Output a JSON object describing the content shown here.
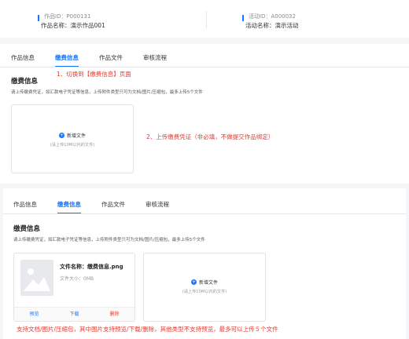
{
  "header": {
    "work_id": "作品ID：P000131",
    "work_name_label": "作品名称：",
    "work_name": "演示作品001",
    "activity_id": "活动ID：A000032",
    "activity_name_label": "活动名称：",
    "activity_name": "演示活动"
  },
  "tabs": [
    "作品信息",
    "缴费信息",
    "作品文件",
    "审核流程"
  ],
  "annotations": {
    "step1": "1、切换到【缴费信息】页面",
    "step2": "2、上传缴费凭证（非必填，不做提交作品绑定）",
    "step3": "支持文档/图片/压缩包，其中图片支持预览/下载/删除，其他类型不支持预览，最多可以上传５个文件"
  },
  "section": {
    "title": "缴费信息",
    "description": "请上传缴费凭证，如汇款电子凭证等信息，上传附件类型只可为文档/图片/压缩包，最多上传5个文件"
  },
  "upload": {
    "label": "新增文件",
    "hint": "(请上传10M以内的文件)"
  },
  "file": {
    "name_label": "文件名称：",
    "name": "缴费信息.png",
    "size_label": "文件大小：",
    "size": "0MB",
    "preview": "预览",
    "download": "下载",
    "delete": "删除"
  },
  "colors": {
    "accent": "#1677ff",
    "annotation": "#e8382e"
  }
}
